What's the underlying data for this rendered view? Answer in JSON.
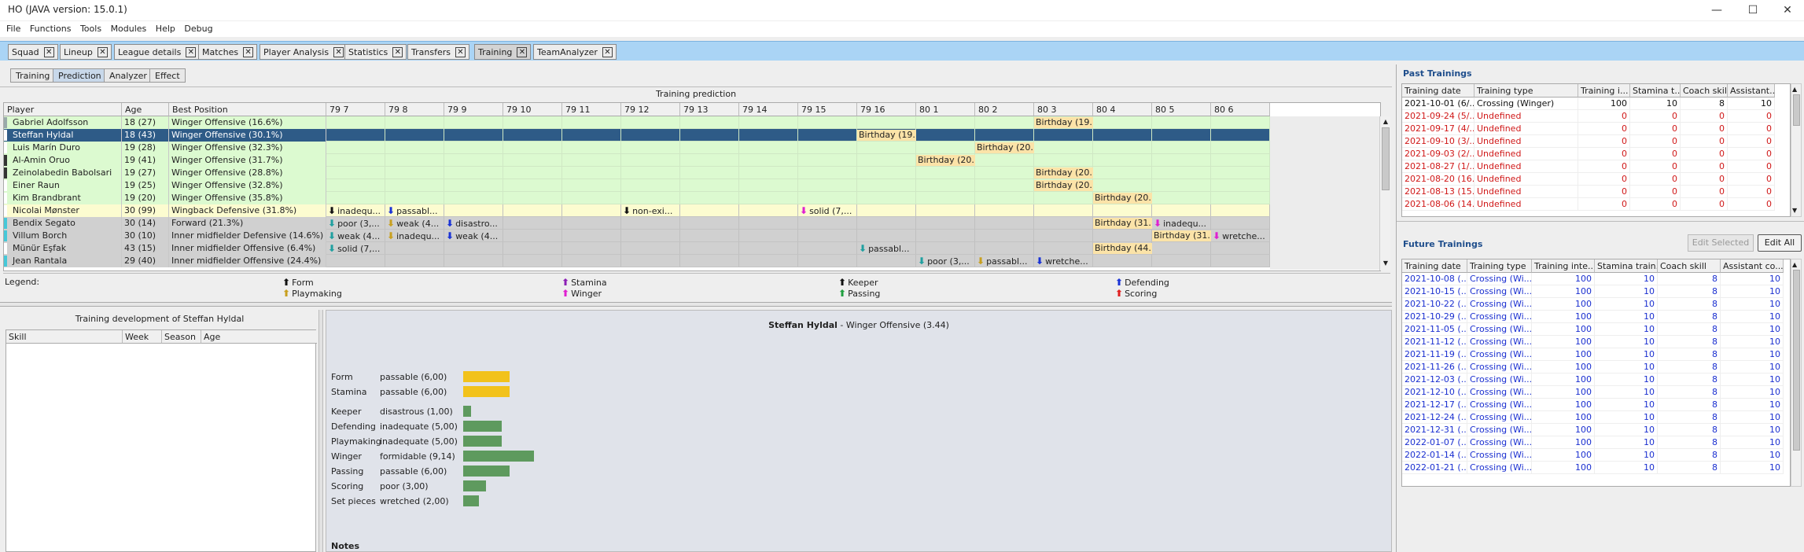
{
  "window": {
    "title": "HO (JAVA version: 15.0.1)",
    "controls": [
      "—",
      "☐",
      "✕"
    ]
  },
  "menu": [
    "File",
    "Functions",
    "Tools",
    "Modules",
    "Help",
    "Debug"
  ],
  "tabs": [
    "Squad",
    "Lineup",
    "League details",
    "Matches",
    "Player Analysis",
    "Statistics",
    "Transfers",
    "Training",
    "TeamAnalyzer"
  ],
  "tab_close": "✕",
  "subtabs": [
    "Training",
    "Prediction",
    "Analyzer",
    "Effect"
  ],
  "prediction": {
    "title": "Training prediction",
    "columns": [
      "Player",
      "Age",
      "Best Position",
      "79 7",
      "79 8",
      "79 9",
      "79 10",
      "79 11",
      "79 12",
      "79 13",
      "79 14",
      "79 15",
      "79 16",
      "80 1",
      "80 2",
      "80 3",
      "80 4",
      "80 5",
      "80 6"
    ],
    "rows": [
      {
        "player": "Gabriel Adolfsson",
        "age": "18 (27)",
        "pos": "Winger Offensive (16.6%)",
        "events": [
          {
            "col": 12,
            "text": "Birthday (19...",
            "type": "b"
          }
        ]
      },
      {
        "player": "Steffan Hyldal",
        "age": "18 (43)",
        "pos": "Winger Offensive (30.1%)",
        "events": [
          {
            "col": 9,
            "text": "Birthday (19...",
            "type": "b"
          }
        ]
      },
      {
        "player": "Luis Marín Duro",
        "age": "19 (28)",
        "pos": "Winger Offensive (32.3%)",
        "events": [
          {
            "col": 11,
            "text": "Birthday (20...",
            "type": "b"
          }
        ]
      },
      {
        "player": "Al-Amin Oruo",
        "age": "19 (41)",
        "pos": "Winger Offensive (31.7%)",
        "events": [
          {
            "col": 10,
            "text": "Birthday (20...",
            "type": "b"
          }
        ]
      },
      {
        "player": "Zeinolabedin Babolsari",
        "age": "19 (27)",
        "pos": "Winger Offensive (28.8%)",
        "events": [
          {
            "col": 12,
            "text": "Birthday (20...",
            "type": "b"
          }
        ]
      },
      {
        "player": "Einer Raun",
        "age": "19 (25)",
        "pos": "Winger Offensive (32.8%)",
        "events": [
          {
            "col": 12,
            "text": "Birthday (20...",
            "type": "b"
          }
        ]
      },
      {
        "player": "Kim Brandbrant",
        "age": "19 (20)",
        "pos": "Winger Offensive (35.8%)",
        "events": [
          {
            "col": 13,
            "text": "Birthday (20...",
            "type": "b"
          }
        ]
      },
      {
        "player": "Nicolai Mønster",
        "age": "30 (99)",
        "pos": "Wingback Defensive (31.8%)",
        "events": [
          {
            "col": 0,
            "text": "inadequ...",
            "type": "form"
          },
          {
            "col": 1,
            "text": "passabl...",
            "type": "def"
          },
          {
            "col": 5,
            "text": "non-exi...",
            "type": "keep"
          },
          {
            "col": 8,
            "text": "solid (7,...",
            "type": "wing"
          }
        ]
      },
      {
        "player": "Bendix Segato",
        "age": "30 (14)",
        "pos": "Forward (21.3%)",
        "events": [
          {
            "col": 0,
            "text": "poor (3,...",
            "type": "pass"
          },
          {
            "col": 1,
            "text": "weak (4...",
            "type": "play"
          },
          {
            "col": 2,
            "text": "disastro...",
            "type": "def"
          },
          {
            "col": 13,
            "text": "Birthday (31...",
            "type": "b"
          },
          {
            "col": 14,
            "text": "inadequ...",
            "type": "wing"
          }
        ]
      },
      {
        "player": "Villum Borch",
        "age": "30 (10)",
        "pos": "Inner midfielder Defensive (14.6%)",
        "events": [
          {
            "col": 0,
            "text": "weak (4...",
            "type": "pass"
          },
          {
            "col": 1,
            "text": "inadequ...",
            "type": "play"
          },
          {
            "col": 2,
            "text": "weak (4...",
            "type": "def"
          },
          {
            "col": 14,
            "text": "Birthday (31...",
            "type": "b"
          },
          {
            "col": 15,
            "text": "wretche...",
            "type": "wing"
          }
        ]
      },
      {
        "player": "Münür Eşfak",
        "age": "43 (15)",
        "pos": "Inner midfielder Offensive (6.4%)",
        "events": [
          {
            "col": 0,
            "text": "solid (7,...",
            "type": "pass"
          },
          {
            "col": 9,
            "text": "passabl...",
            "type": "pass"
          },
          {
            "col": 13,
            "text": "Birthday (44...",
            "type": "b"
          }
        ]
      },
      {
        "player": "Jean Rantala",
        "age": "29 (40)",
        "pos": "Inner midfielder Offensive (24.4%)",
        "events": [
          {
            "col": 10,
            "text": "poor (3,...",
            "type": "pass"
          },
          {
            "col": 11,
            "text": "passabl...",
            "type": "play"
          },
          {
            "col": 12,
            "text": "wretche...",
            "type": "def"
          }
        ]
      }
    ]
  },
  "legend": {
    "label": "Legend:",
    "items": [
      {
        "name": "Form",
        "color": "#111111"
      },
      {
        "name": "Stamina",
        "color": "#8b1fb5"
      },
      {
        "name": "Keeper",
        "color": "#111111"
      },
      {
        "name": "Defending",
        "color": "#1a33d6"
      },
      {
        "name": "Playmaking",
        "color": "#c8a020"
      },
      {
        "name": "Winger",
        "color": "#e020d0"
      },
      {
        "name": "Passing",
        "color": "#20a040"
      },
      {
        "name": "Scoring",
        "color": "#e02020"
      }
    ]
  },
  "development": {
    "title": "Training development of Steffan Hyldal",
    "columns": [
      "Skill",
      "Week",
      "Season",
      "Age"
    ]
  },
  "player_detail": {
    "name": "Steffan Hyldal",
    "subtitle": " - Winger Offensive (3.44)",
    "skills": [
      {
        "name": "Form",
        "value": "passable (6,00)",
        "level": 6.0,
        "color": "#f2c21b"
      },
      {
        "name": "Stamina",
        "value": "passable (6,00)",
        "level": 6.0,
        "color": "#f2c21b"
      },
      {
        "name": "Keeper",
        "value": "disastrous (1,00)",
        "level": 1.0,
        "color": "#5e9a5e"
      },
      {
        "name": "Defending",
        "value": "inadequate (5,00)",
        "level": 5.0,
        "color": "#5e9a5e"
      },
      {
        "name": "Playmaking",
        "value": "inadequate (5,00)",
        "level": 5.0,
        "color": "#5e9a5e"
      },
      {
        "name": "Winger",
        "value": "formidable (9,14)",
        "level": 9.14,
        "color": "#5e9a5e"
      },
      {
        "name": "Passing",
        "value": "passable (6,00)",
        "level": 6.0,
        "color": "#5e9a5e"
      },
      {
        "name": "Scoring",
        "value": "poor (3,00)",
        "level": 3.0,
        "color": "#5e9a5e"
      },
      {
        "name": "Set pieces",
        "value": "wretched (2,00)",
        "level": 2.0,
        "color": "#5e9a5e"
      }
    ],
    "notes_label": "Notes"
  },
  "past_trainings": {
    "title": "Past Trainings",
    "columns": [
      "Training date",
      "Training type",
      "Training i...",
      "Stamina t...",
      "Coach skill",
      "Assistant..."
    ],
    "rows": [
      [
        "2021-10-01 (6/...",
        "Crossing (Winger)",
        "100",
        "10",
        "8",
        "10"
      ],
      [
        "2021-09-24 (5/...",
        "Undefined",
        "0",
        "0",
        "0",
        "0"
      ],
      [
        "2021-09-17 (4/...",
        "Undefined",
        "0",
        "0",
        "0",
        "0"
      ],
      [
        "2021-09-10 (3/...",
        "Undefined",
        "0",
        "0",
        "0",
        "0"
      ],
      [
        "2021-09-03 (2/...",
        "Undefined",
        "0",
        "0",
        "0",
        "0"
      ],
      [
        "2021-08-27 (1/...",
        "Undefined",
        "0",
        "0",
        "0",
        "0"
      ],
      [
        "2021-08-20 (16...",
        "Undefined",
        "0",
        "0",
        "0",
        "0"
      ],
      [
        "2021-08-13 (15...",
        "Undefined",
        "0",
        "0",
        "0",
        "0"
      ],
      [
        "2021-08-06 (14...",
        "Undefined",
        "0",
        "0",
        "0",
        "0"
      ]
    ]
  },
  "future_trainings": {
    "title": "Future Trainings",
    "edit_selected": "Edit Selected",
    "edit_all": "Edit All",
    "columns": [
      "Training date",
      "Training type",
      "Training inte...",
      "Stamina train...",
      "Coach skill",
      "Assistant co..."
    ],
    "rows": [
      [
        "2021-10-08 (...",
        "Crossing (Wi...",
        "100",
        "10",
        "8",
        "10"
      ],
      [
        "2021-10-15 (...",
        "Crossing (Wi...",
        "100",
        "10",
        "8",
        "10"
      ],
      [
        "2021-10-22 (...",
        "Crossing (Wi...",
        "100",
        "10",
        "8",
        "10"
      ],
      [
        "2021-10-29 (...",
        "Crossing (Wi...",
        "100",
        "10",
        "8",
        "10"
      ],
      [
        "2021-11-05 (...",
        "Crossing (Wi...",
        "100",
        "10",
        "8",
        "10"
      ],
      [
        "2021-11-12 (...",
        "Crossing (Wi...",
        "100",
        "10",
        "8",
        "10"
      ],
      [
        "2021-11-19 (...",
        "Crossing (Wi...",
        "100",
        "10",
        "8",
        "10"
      ],
      [
        "2021-11-26 (...",
        "Crossing (Wi...",
        "100",
        "10",
        "8",
        "10"
      ],
      [
        "2021-12-03 (...",
        "Crossing (Wi...",
        "100",
        "10",
        "8",
        "10"
      ],
      [
        "2021-12-10 (...",
        "Crossing (Wi...",
        "100",
        "10",
        "8",
        "10"
      ],
      [
        "2021-12-17 (...",
        "Crossing (Wi...",
        "100",
        "10",
        "8",
        "10"
      ],
      [
        "2021-12-24 (...",
        "Crossing (Wi...",
        "100",
        "10",
        "8",
        "10"
      ],
      [
        "2021-12-31 (...",
        "Crossing (Wi...",
        "100",
        "10",
        "8",
        "10"
      ],
      [
        "2022-01-07 (...",
        "Crossing (Wi...",
        "100",
        "10",
        "8",
        "10"
      ],
      [
        "2022-01-14 (...",
        "Crossing (Wi...",
        "100",
        "10",
        "8",
        "10"
      ],
      [
        "2022-01-21 (...",
        "Crossing (Wi...",
        "100",
        "10",
        "8",
        "10"
      ]
    ]
  }
}
